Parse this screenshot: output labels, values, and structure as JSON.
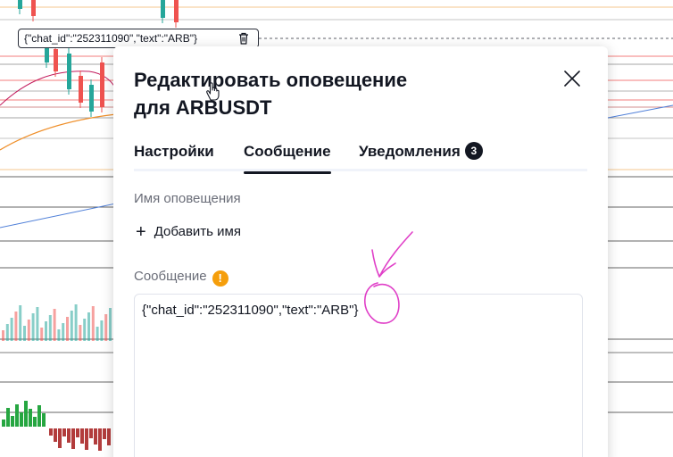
{
  "alert_label": {
    "text": "{\"chat_id\":\"252311090\",\"text\":\"ARB\"}"
  },
  "dialog": {
    "title_line1": "Редактировать оповещение",
    "title_line2": "для ARBUSDT",
    "tabs": [
      {
        "label": "Настройки",
        "active": false
      },
      {
        "label": "Сообщение",
        "active": true
      },
      {
        "label": "Уведомления",
        "active": false,
        "badge": "3"
      }
    ],
    "alert_name_label": "Имя оповещения",
    "add_name_label": "Добавить имя",
    "message_label": "Сообщение",
    "message_value": "{\"chat_id\":\"252311090\",\"text\":\"ARB\"}"
  },
  "colors": {
    "warning": "#f59e0b",
    "annotation": "#e040c8",
    "bull": "#26a69a",
    "bear": "#ef5350"
  }
}
